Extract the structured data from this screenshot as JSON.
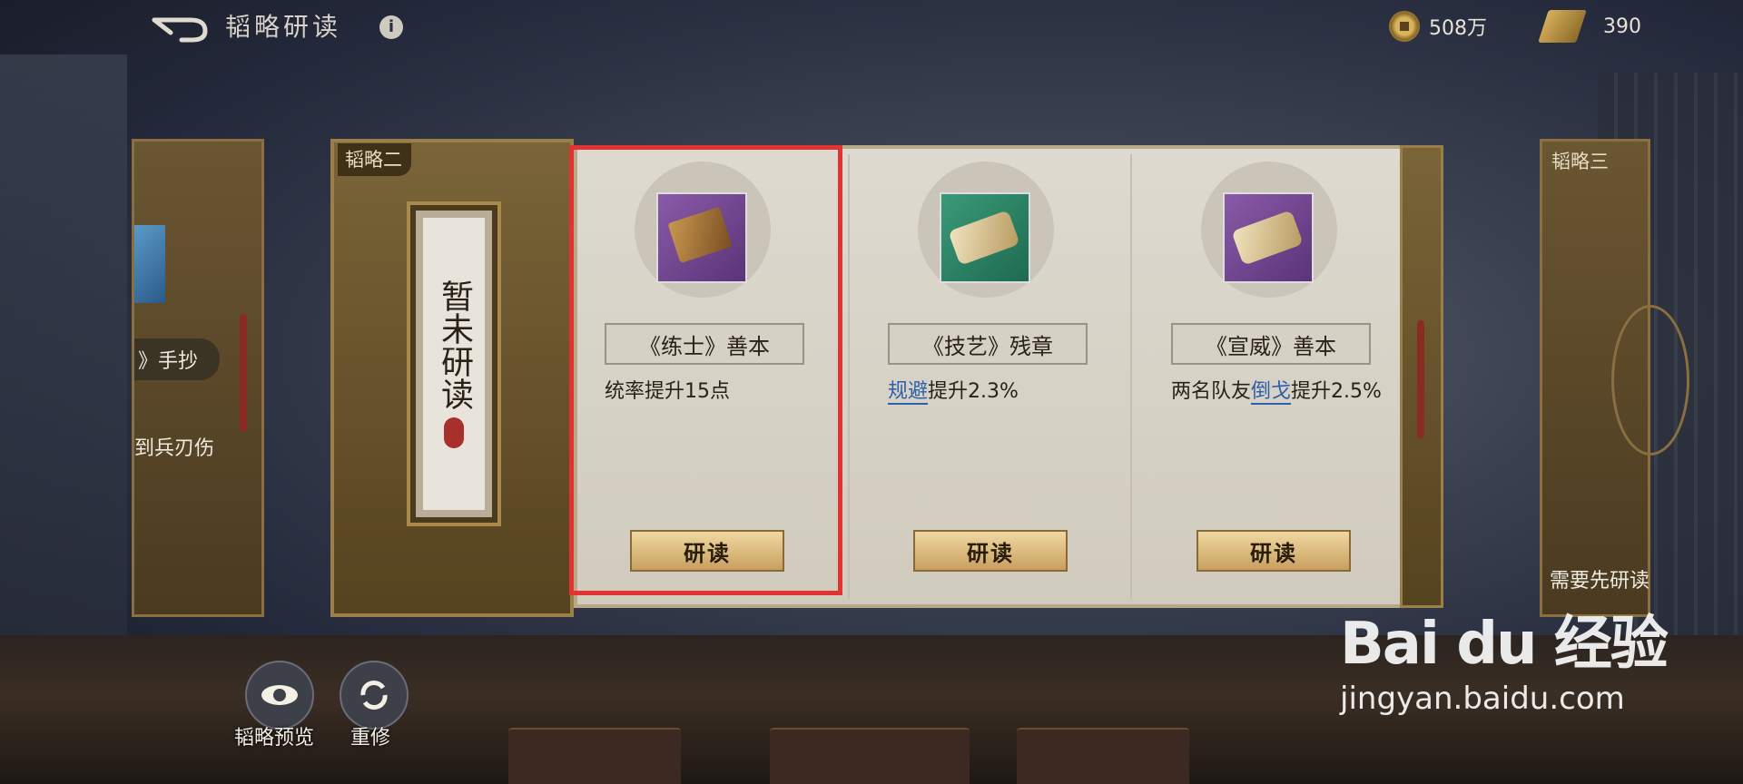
{
  "header": {
    "title": "韬略研读",
    "info_icon": "i",
    "coins": "508万",
    "scrolls": "390"
  },
  "left_panel": {
    "item_name": "》手抄",
    "desc": "到兵刃伤"
  },
  "current_group": {
    "tag": "韬略二",
    "status_vertical": "暂未研读"
  },
  "cards": [
    {
      "name": "《练士》善本",
      "desc_prefix": "统率提升15点",
      "desc_highlight": "",
      "desc_suffix": "",
      "button": "研读"
    },
    {
      "name": "《技艺》残章",
      "desc_prefix": "",
      "desc_highlight": "规避",
      "desc_suffix": "提升2.3%",
      "button": "研读"
    },
    {
      "name": "《宣威》善本",
      "desc_prefix": "两名队友",
      "desc_highlight": "倒戈",
      "desc_suffix": "提升2.5%",
      "button": "研读"
    }
  ],
  "right_panel": {
    "tag": "韬略三",
    "desc": "需要先研读"
  },
  "bottom": {
    "preview_label": "韬略预览",
    "reset_label": "重修"
  },
  "watermark": {
    "logo": "Bai du 经验",
    "url": "jingyan.baidu.com"
  },
  "colors": {
    "highlight_box": "#e23232",
    "link_blue": "#2f5fa8"
  }
}
